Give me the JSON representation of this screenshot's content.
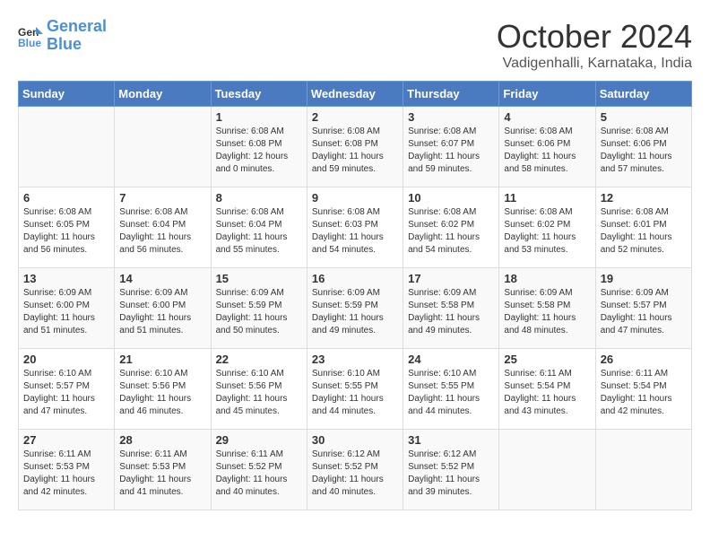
{
  "header": {
    "logo_line1": "General",
    "logo_line2": "Blue",
    "month": "October 2024",
    "location": "Vadigenhalli, Karnataka, India"
  },
  "weekdays": [
    "Sunday",
    "Monday",
    "Tuesday",
    "Wednesday",
    "Thursday",
    "Friday",
    "Saturday"
  ],
  "weeks": [
    [
      {
        "day": "",
        "info": ""
      },
      {
        "day": "",
        "info": ""
      },
      {
        "day": "1",
        "info": "Sunrise: 6:08 AM\nSunset: 6:08 PM\nDaylight: 12 hours\nand 0 minutes."
      },
      {
        "day": "2",
        "info": "Sunrise: 6:08 AM\nSunset: 6:08 PM\nDaylight: 11 hours\nand 59 minutes."
      },
      {
        "day": "3",
        "info": "Sunrise: 6:08 AM\nSunset: 6:07 PM\nDaylight: 11 hours\nand 59 minutes."
      },
      {
        "day": "4",
        "info": "Sunrise: 6:08 AM\nSunset: 6:06 PM\nDaylight: 11 hours\nand 58 minutes."
      },
      {
        "day": "5",
        "info": "Sunrise: 6:08 AM\nSunset: 6:06 PM\nDaylight: 11 hours\nand 57 minutes."
      }
    ],
    [
      {
        "day": "6",
        "info": "Sunrise: 6:08 AM\nSunset: 6:05 PM\nDaylight: 11 hours\nand 56 minutes."
      },
      {
        "day": "7",
        "info": "Sunrise: 6:08 AM\nSunset: 6:04 PM\nDaylight: 11 hours\nand 56 minutes."
      },
      {
        "day": "8",
        "info": "Sunrise: 6:08 AM\nSunset: 6:04 PM\nDaylight: 11 hours\nand 55 minutes."
      },
      {
        "day": "9",
        "info": "Sunrise: 6:08 AM\nSunset: 6:03 PM\nDaylight: 11 hours\nand 54 minutes."
      },
      {
        "day": "10",
        "info": "Sunrise: 6:08 AM\nSunset: 6:02 PM\nDaylight: 11 hours\nand 54 minutes."
      },
      {
        "day": "11",
        "info": "Sunrise: 6:08 AM\nSunset: 6:02 PM\nDaylight: 11 hours\nand 53 minutes."
      },
      {
        "day": "12",
        "info": "Sunrise: 6:08 AM\nSunset: 6:01 PM\nDaylight: 11 hours\nand 52 minutes."
      }
    ],
    [
      {
        "day": "13",
        "info": "Sunrise: 6:09 AM\nSunset: 6:00 PM\nDaylight: 11 hours\nand 51 minutes."
      },
      {
        "day": "14",
        "info": "Sunrise: 6:09 AM\nSunset: 6:00 PM\nDaylight: 11 hours\nand 51 minutes."
      },
      {
        "day": "15",
        "info": "Sunrise: 6:09 AM\nSunset: 5:59 PM\nDaylight: 11 hours\nand 50 minutes."
      },
      {
        "day": "16",
        "info": "Sunrise: 6:09 AM\nSunset: 5:59 PM\nDaylight: 11 hours\nand 49 minutes."
      },
      {
        "day": "17",
        "info": "Sunrise: 6:09 AM\nSunset: 5:58 PM\nDaylight: 11 hours\nand 49 minutes."
      },
      {
        "day": "18",
        "info": "Sunrise: 6:09 AM\nSunset: 5:58 PM\nDaylight: 11 hours\nand 48 minutes."
      },
      {
        "day": "19",
        "info": "Sunrise: 6:09 AM\nSunset: 5:57 PM\nDaylight: 11 hours\nand 47 minutes."
      }
    ],
    [
      {
        "day": "20",
        "info": "Sunrise: 6:10 AM\nSunset: 5:57 PM\nDaylight: 11 hours\nand 47 minutes."
      },
      {
        "day": "21",
        "info": "Sunrise: 6:10 AM\nSunset: 5:56 PM\nDaylight: 11 hours\nand 46 minutes."
      },
      {
        "day": "22",
        "info": "Sunrise: 6:10 AM\nSunset: 5:56 PM\nDaylight: 11 hours\nand 45 minutes."
      },
      {
        "day": "23",
        "info": "Sunrise: 6:10 AM\nSunset: 5:55 PM\nDaylight: 11 hours\nand 44 minutes."
      },
      {
        "day": "24",
        "info": "Sunrise: 6:10 AM\nSunset: 5:55 PM\nDaylight: 11 hours\nand 44 minutes."
      },
      {
        "day": "25",
        "info": "Sunrise: 6:11 AM\nSunset: 5:54 PM\nDaylight: 11 hours\nand 43 minutes."
      },
      {
        "day": "26",
        "info": "Sunrise: 6:11 AM\nSunset: 5:54 PM\nDaylight: 11 hours\nand 42 minutes."
      }
    ],
    [
      {
        "day": "27",
        "info": "Sunrise: 6:11 AM\nSunset: 5:53 PM\nDaylight: 11 hours\nand 42 minutes."
      },
      {
        "day": "28",
        "info": "Sunrise: 6:11 AM\nSunset: 5:53 PM\nDaylight: 11 hours\nand 41 minutes."
      },
      {
        "day": "29",
        "info": "Sunrise: 6:11 AM\nSunset: 5:52 PM\nDaylight: 11 hours\nand 40 minutes."
      },
      {
        "day": "30",
        "info": "Sunrise: 6:12 AM\nSunset: 5:52 PM\nDaylight: 11 hours\nand 40 minutes."
      },
      {
        "day": "31",
        "info": "Sunrise: 6:12 AM\nSunset: 5:52 PM\nDaylight: 11 hours\nand 39 minutes."
      },
      {
        "day": "",
        "info": ""
      },
      {
        "day": "",
        "info": ""
      }
    ]
  ]
}
